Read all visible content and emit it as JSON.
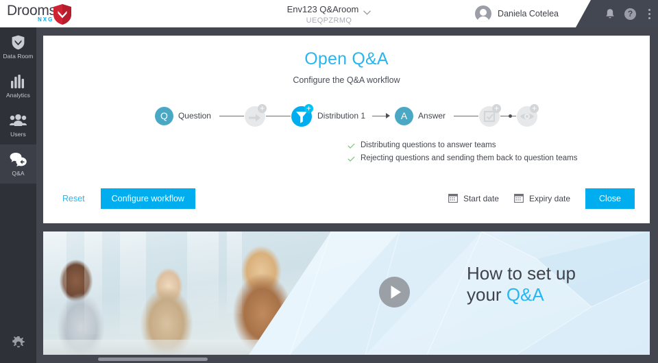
{
  "header": {
    "logo_text": "Drooms",
    "logo_sub": "NXG",
    "room_name": "Env123 Q&Aroom",
    "room_code": "UEQPZRMQ",
    "user_name": "Daniela Cotelea",
    "icons": {
      "bell": "bell-icon",
      "help": "?",
      "more": "kebab-icon"
    }
  },
  "sidebar": {
    "items": [
      {
        "label": "Data Room",
        "icon": "shield-icon",
        "active": false
      },
      {
        "label": "Analytics",
        "icon": "bar-chart-icon",
        "active": false
      },
      {
        "label": "Users",
        "icon": "users-icon",
        "active": false
      },
      {
        "label": "Q&A",
        "icon": "speech-bubbles-icon",
        "active": true
      }
    ],
    "settings_label": "Settings",
    "settings_icon": "gear-icon"
  },
  "card": {
    "title": "Open Q&A",
    "subtitle": "Configure the Q&A workflow",
    "workflow": {
      "question_letter": "Q",
      "question_label": "Question",
      "approval_icon": "arrow-forward-plus-icon",
      "distribution_icon": "funnel-plus-icon",
      "distribution_label": "Distribution 1",
      "answer_letter": "A",
      "answer_label": "Answer",
      "review_icon": "clipboard-check-plus-icon",
      "publish_icon": "eye-plus-icon"
    },
    "bullets": [
      "Distributing questions to answer teams",
      "Rejecting questions and sending them back to question teams"
    ],
    "footer": {
      "reset_label": "Reset",
      "configure_label": "Configure workflow",
      "start_date_label": "Start date",
      "expiry_date_label": "Expiry date",
      "close_label": "Close",
      "calendar_icon": "calendar-icon"
    }
  },
  "banner": {
    "line1": "How to set up",
    "line2_prefix": "your ",
    "line2_highlight": "Q&A",
    "play_icon": "play-icon"
  },
  "colors": {
    "accent": "#00aeef",
    "accent_light": "#29b6ef",
    "node_teal": "#4ba8c4",
    "disabled_gray": "#e0e2e4",
    "dark_chrome": "#43454f",
    "sidebar": "#2f3139",
    "check_green": "#7dc37d"
  }
}
